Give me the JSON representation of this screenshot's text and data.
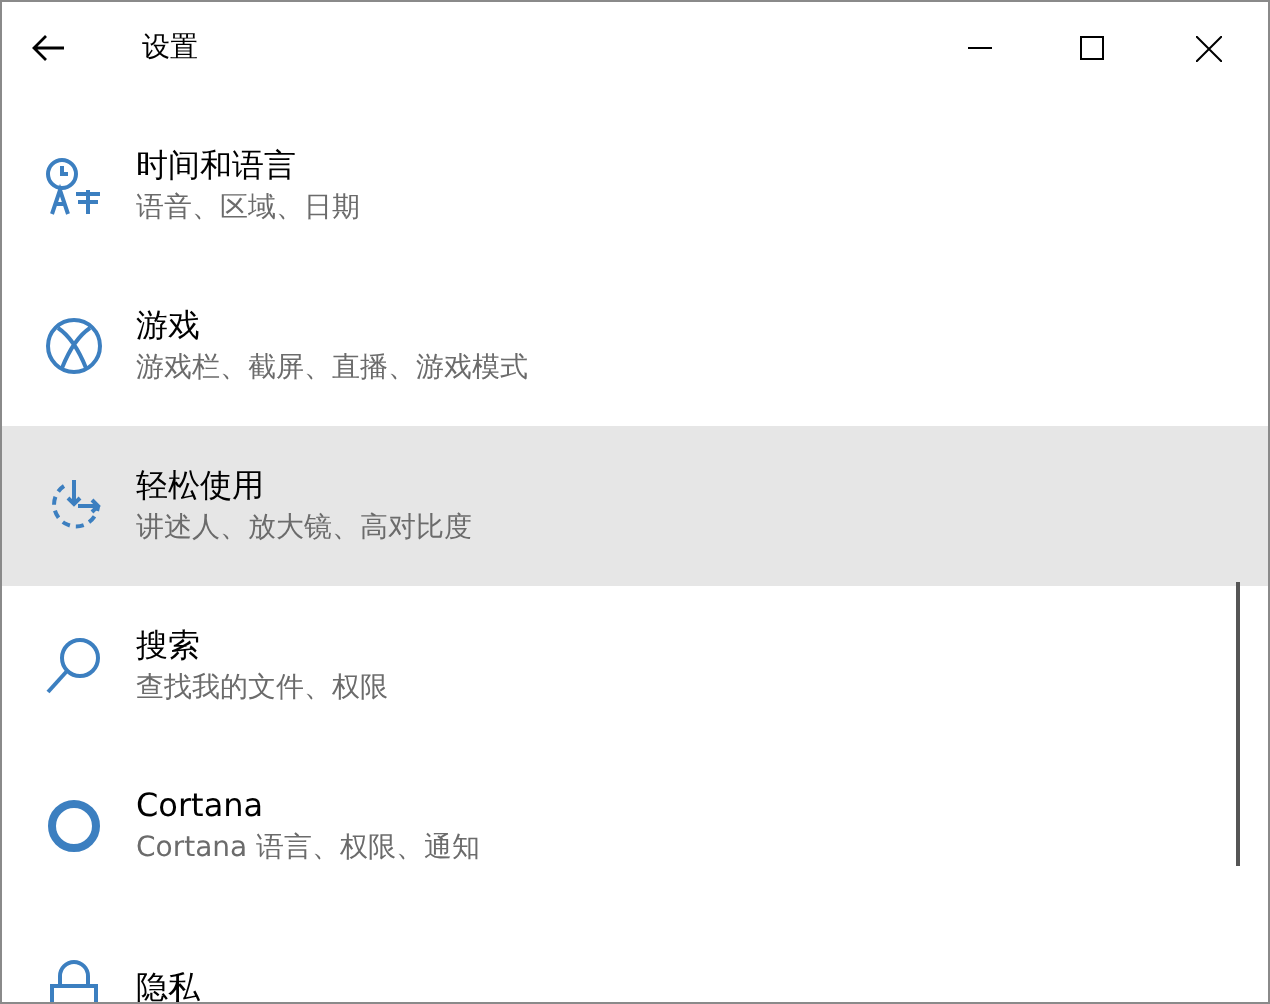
{
  "window": {
    "title": "设置"
  },
  "items": [
    {
      "title": "时间和语言",
      "subtitle": "语音、区域、日期",
      "selected": false
    },
    {
      "title": "游戏",
      "subtitle": "游戏栏、截屏、直播、游戏模式",
      "selected": false
    },
    {
      "title": "轻松使用",
      "subtitle": "讲述人、放大镜、高对比度",
      "selected": true
    },
    {
      "title": "搜索",
      "subtitle": "查找我的文件、权限",
      "selected": false
    },
    {
      "title": "Cortana",
      "subtitle": "Cortana 语言、权限、通知",
      "selected": false
    },
    {
      "title": "隐私",
      "selected": false
    }
  ]
}
